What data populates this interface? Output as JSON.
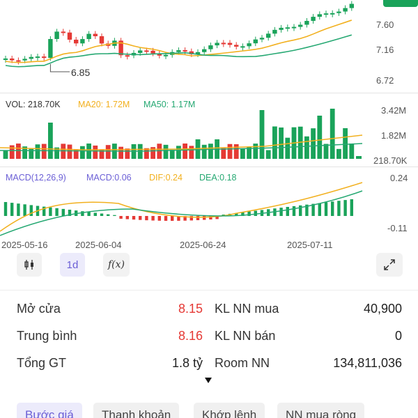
{
  "price": {
    "axis_labels": [
      "7.60",
      "7.16",
      "6.72"
    ],
    "low_marker": "6.85",
    "badge_color": "#1aa35a"
  },
  "volume": {
    "vol_label": "VOL: 218.70K",
    "ma20_label": "MA20: 1.72M",
    "ma50_label": "MA50: 1.17M",
    "axis_labels": [
      "3.42M",
      "1.82M",
      "218.70K"
    ]
  },
  "macd": {
    "title": "MACD(12,26,9)",
    "macd_label": "MACD:0.06",
    "dif_label": "DIF:0.24",
    "dea_label": "DEA:0.18",
    "axis_labels": [
      "0.24",
      "-0.11"
    ]
  },
  "dates": [
    "2025-05-16",
    "2025-06-04",
    "2025-06-24",
    "2025-07-11"
  ],
  "toolbar": {
    "chart_type_icon": "candlestick-icon",
    "interval_label": "1d",
    "indicator_label": "f(x)",
    "expand_icon": "expand-icon"
  },
  "stats": {
    "open_label": "Mở cửa",
    "open_value": "8.15",
    "avg_label": "Trung bình",
    "avg_value": "8.16",
    "total_label": "Tổng GT",
    "total_value": "1.8 tỷ",
    "fbuy_label": "KL NN mua",
    "fbuy_value": "40,900",
    "fsell_label": "KL NN bán",
    "fsell_value": "0",
    "room_label": "Room NN",
    "room_value": "134,811,036"
  },
  "tabs": [
    "Bước giá",
    "Thanh khoản",
    "Khớp lệnh",
    "NN mua ròng"
  ],
  "colors": {
    "up": "#1aa35a",
    "down": "#e53935",
    "ma_yellow": "#f2b01e",
    "ma_green": "#25a872",
    "macd_purple": "#6b5fd6",
    "accent_tab": "#ecebfb"
  }
}
